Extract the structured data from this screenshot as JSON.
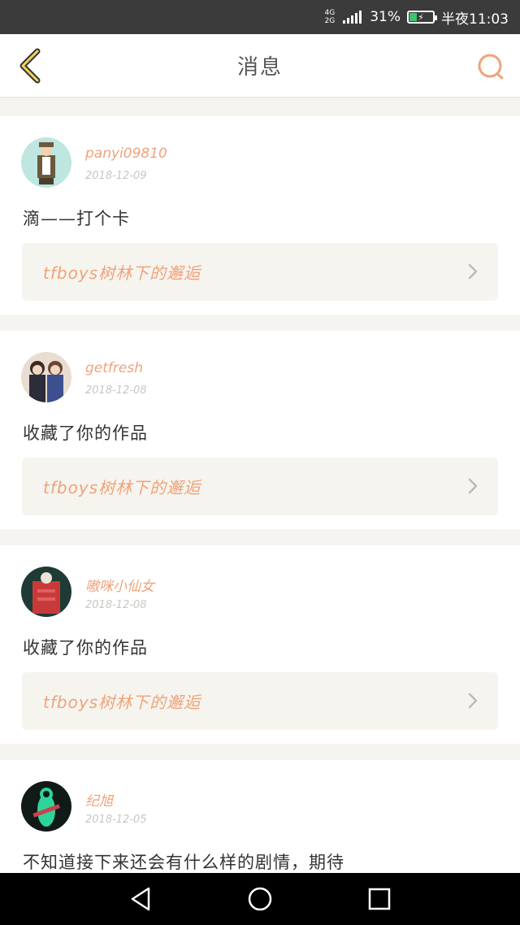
{
  "status_bar": {
    "network_top": "4G",
    "network_bottom": "2G",
    "battery_percent": "31%",
    "time": "半夜11:03",
    "battery_fill": 0.31
  },
  "header": {
    "title": "消息",
    "back_icon": "chevron-left-icon",
    "search_icon": "search-icon",
    "accent_color": "#f0a27a"
  },
  "messages": [
    {
      "username": "panyi09810",
      "date": "2018-12-09",
      "text": "滴——打个卡",
      "link": "tfboys树林下的邂逅"
    },
    {
      "username": "getfresh",
      "date": "2018-12-08",
      "text": "收藏了你的作品",
      "link": "tfboys树林下的邂逅"
    },
    {
      "username": "嗷咪小仙女",
      "date": "2018-12-08",
      "text": "收藏了你的作品",
      "link": "tfboys树林下的邂逅"
    },
    {
      "username": "纪旭",
      "date": "2018-12-05",
      "text": "不知道接下来还会有什么样的剧情，期待"
    }
  ],
  "nav_bar": {
    "icons": [
      "back-triangle-icon",
      "home-circle-icon",
      "recents-square-icon"
    ]
  }
}
